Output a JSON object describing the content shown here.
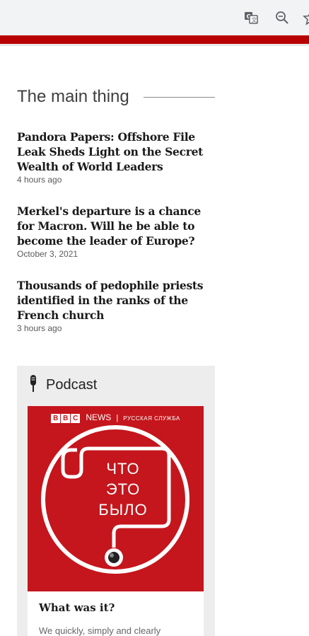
{
  "browser": {
    "translate_icon": "translate-icon",
    "zoom_icon": "zoom-out-icon",
    "bookmark_icon": "star-icon"
  },
  "colors": {
    "brand_red": "#b80000",
    "cover_red": "#c4161c"
  },
  "section": {
    "title": "The main thing"
  },
  "articles": [
    {
      "title": "Pandora Papers: Offshore File Leak Sheds Light on the Secret Wealth of World Leaders",
      "time": "4 hours ago"
    },
    {
      "title": "Merkel's departure is a chance for Macron. Will he be able to become the leader of Europe?",
      "time": "October 3, 2021"
    },
    {
      "title": "Thousands of pedophile priests identified in the ranks of the French church",
      "time": "3 hours ago"
    }
  ],
  "podcast": {
    "label": "Podcast",
    "icon": "microphone-icon",
    "cover": {
      "bbc": [
        "B",
        "B",
        "C"
      ],
      "news": "NEWS",
      "separator": "|",
      "service": "РУССКАЯ СЛУЖБА",
      "lines": [
        "ЧТО",
        "ЭТО",
        "БЫЛО"
      ]
    },
    "title": "What was it?",
    "description": "We quickly, simply and clearly"
  }
}
